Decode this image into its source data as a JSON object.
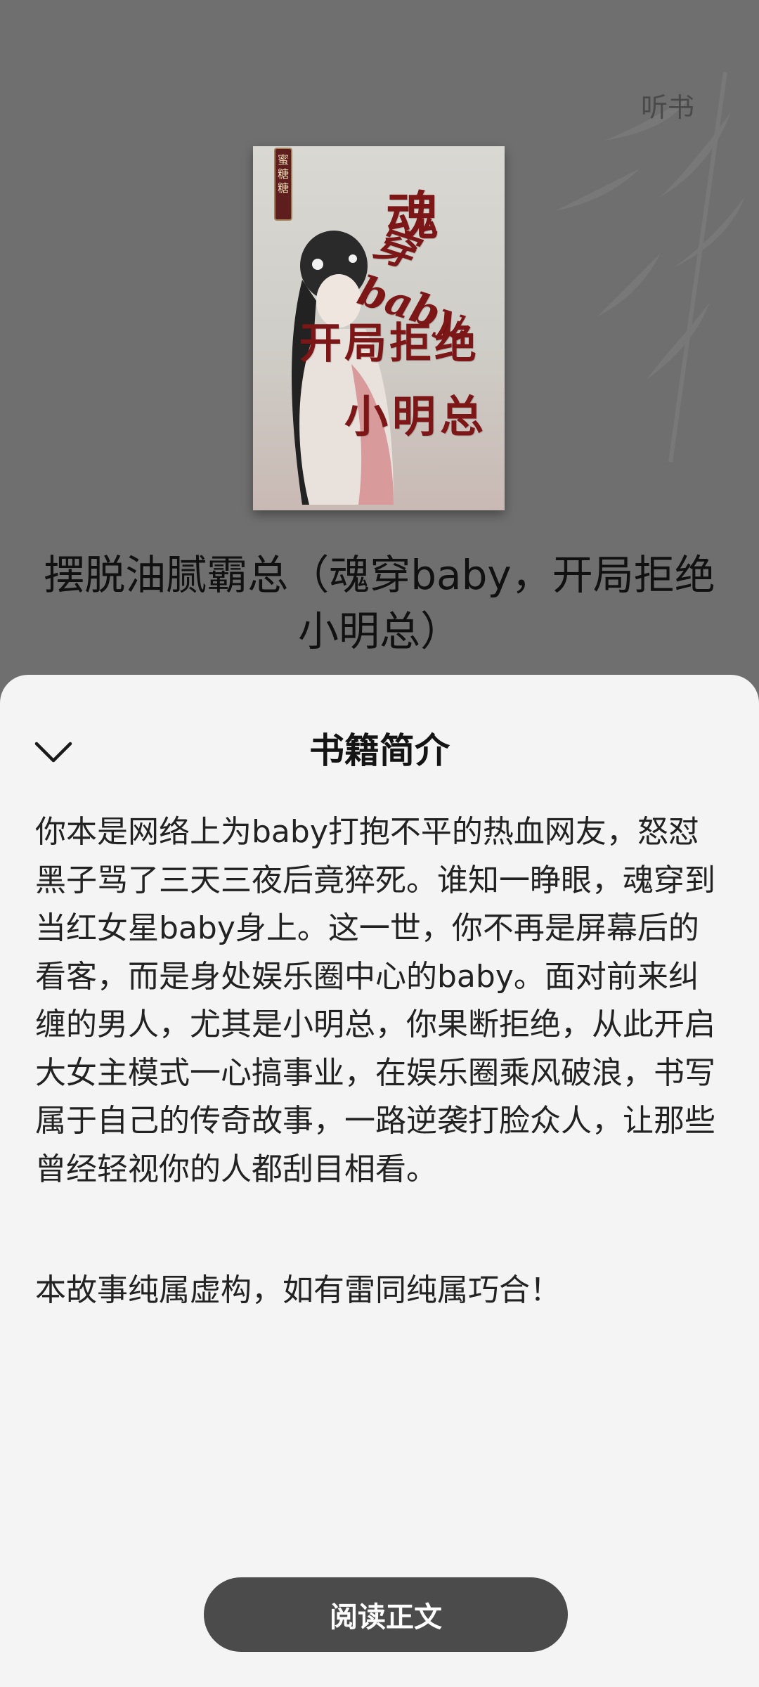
{
  "header": {
    "listen_label": "听书"
  },
  "cover": {
    "author_tag": "蜜糖糖",
    "title_line1": "魂",
    "title_line2": "穿baby,",
    "title_line3": "开局拒绝",
    "title_line4": "小明总"
  },
  "book": {
    "title": "摆脱油腻霸总（魂穿baby，开局拒绝小明总）"
  },
  "sheet": {
    "title": "书籍简介",
    "intro": "你本是网络上为baby打抱不平的热血网友，怒怼黑子骂了三天三夜后竟猝死。谁知一睁眼，魂穿到当红女星baby身上。这一世，你不再是屏幕后的看客，而是身处娱乐圈中心的baby。面对前来纠缠的男人，尤其是小明总，你果断拒绝，从此开启大女主模式一心搞事业，在娱乐圈乘风破浪，书写属于自己的传奇故事，一路逆袭打脸众人，让那些曾经轻视你的人都刮目相看。",
    "disclaimer": "本故事纯属虚构，如有雷同纯属巧合！",
    "read_button": "阅读正文"
  },
  "colors": {
    "overlay": "#6f6f6f",
    "sheet_bg": "#f4f4f4",
    "button_bg": "#4b4b4b",
    "cover_title": "#7d1616"
  }
}
